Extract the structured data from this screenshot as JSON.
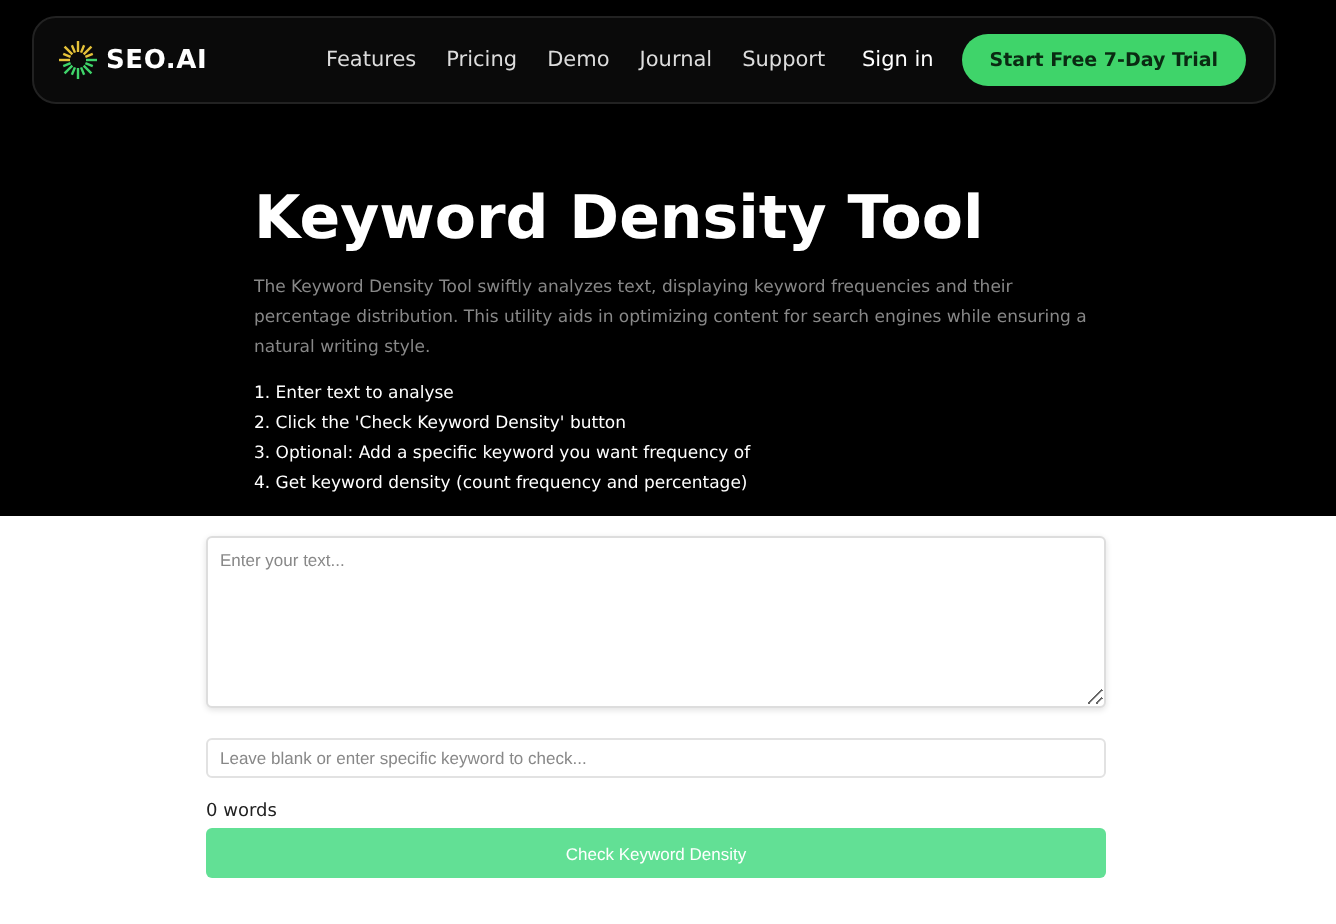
{
  "nav": {
    "logo": "SEO.AI",
    "links": [
      "Features",
      "Pricing",
      "Demo",
      "Journal",
      "Support"
    ],
    "sign_in": "Sign in",
    "cta": "Start Free 7-Day Trial"
  },
  "hero": {
    "title": "Keyword Density Tool",
    "description": "The Keyword Density Tool swiftly analyzes text, displaying keyword frequencies and their percentage distribution. This utility aids in optimizing content for search engines while ensuring a natural writing style.",
    "steps": [
      "1. Enter text to analyse",
      "2. Click the 'Check Keyword Density' button",
      "3. Optional: Add a specific keyword you want frequency of",
      "4. Get keyword density (count frequency and percentage)"
    ]
  },
  "form": {
    "text_placeholder": "Enter your text...",
    "keyword_placeholder": "Leave blank or enter specific keyword to check...",
    "word_count": "0 words",
    "button": "Check Keyword Density"
  }
}
